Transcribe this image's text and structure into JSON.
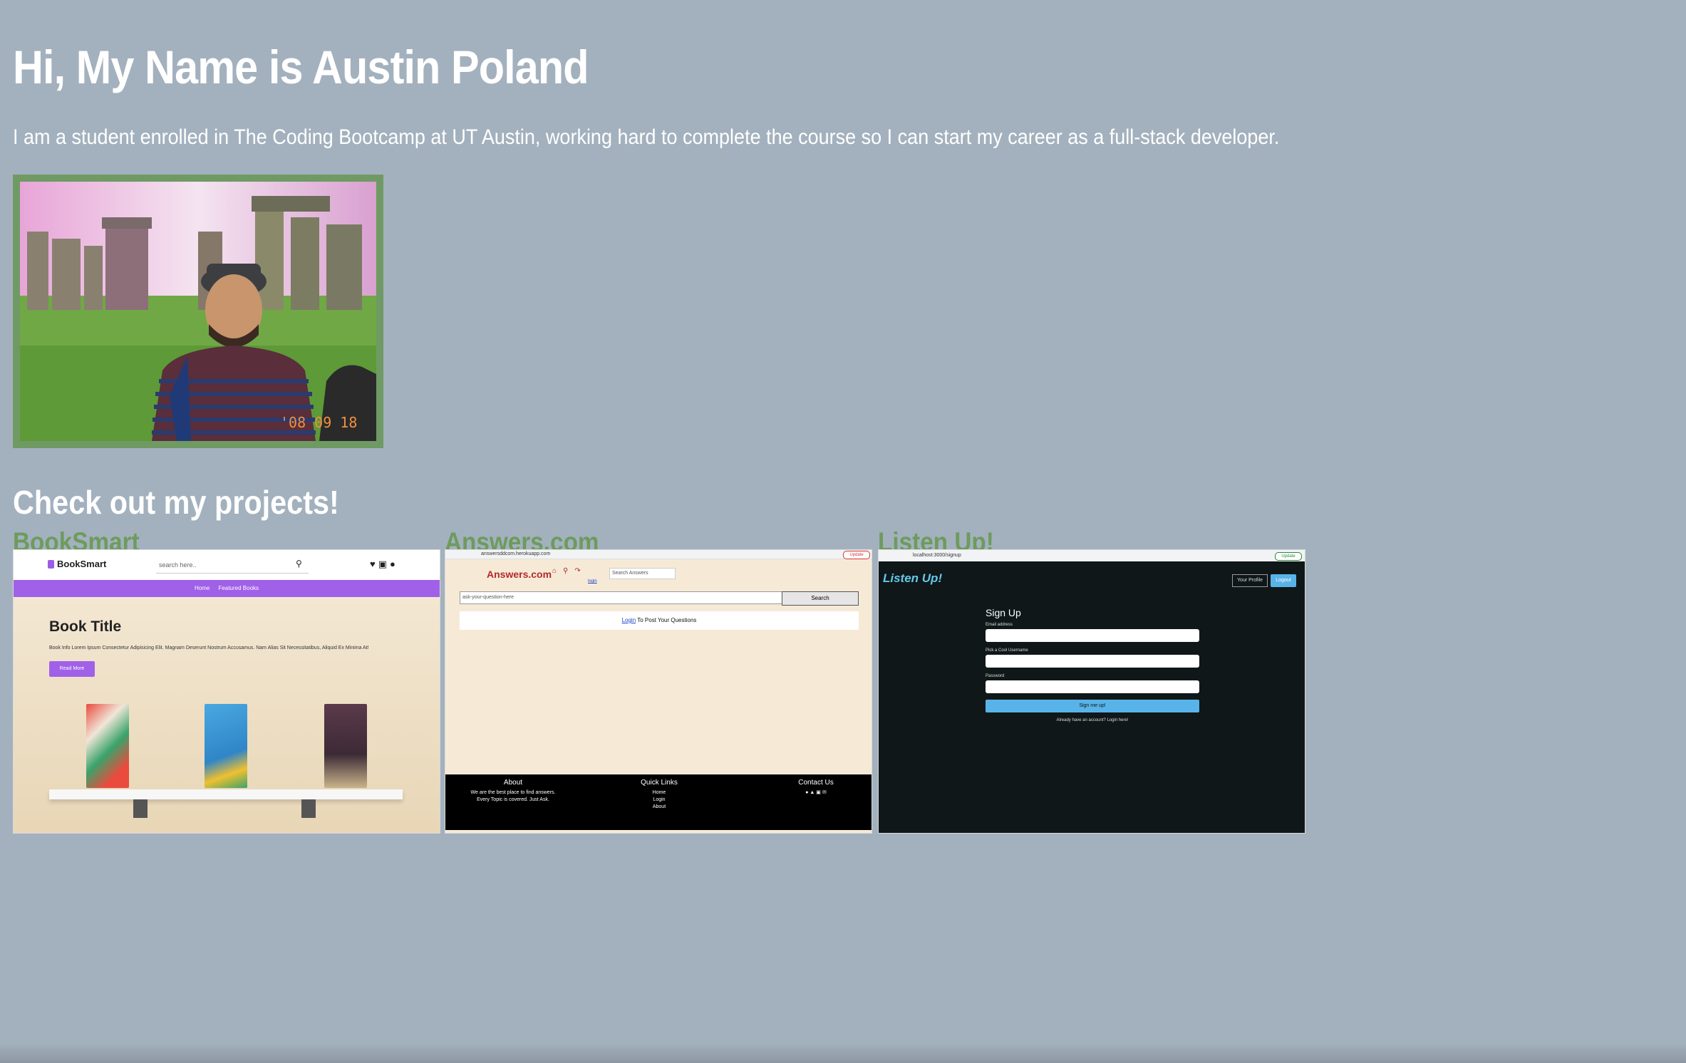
{
  "hero": {
    "title": "Hi, My Name is Austin Poland",
    "intro": "I am a student enrolled in The Coding Bootcamp at UT Austin, working hard to complete the course so I can start my career as a full-stack developer.",
    "photo_date_stamp": "'08 09 18"
  },
  "colors": {
    "background": "#a3b1be",
    "accent_green": "#6d9b5e",
    "photo_frame": "#6f9a64"
  },
  "projects": {
    "heading": "Check out my projects!",
    "items": [
      {
        "title": "BookSmart",
        "screenshot": {
          "logo": "BookSmart",
          "search_placeholder": "search here..",
          "nav": [
            "Home",
            "Featured Books"
          ],
          "book_title": "Book Title",
          "book_info": "Book Info Lorem Ipsum Consectetur Adipisicing Elit. Magnam Deserunt Nostrum Accusamus. Nam Alias Sit Necessitatibus, Aliquid Ex Minima At!",
          "read_more": "Read More"
        }
      },
      {
        "title": "Answers.com",
        "screenshot": {
          "url": "answersddcom.herokuapp.com",
          "browser_update": "Update",
          "brand": "Answers.com",
          "login_small": "login",
          "search_placeholder": "Search Answers",
          "question_placeholder": "ask-your-question-here",
          "search_button": "Search",
          "login_link": "Login",
          "login_prompt": " To Post Your Questions",
          "footer": {
            "about_heading": "About",
            "about_text_1": "We are the best place to find answers.",
            "about_text_2": "Every Topic is covered. Just Ask.",
            "links_heading": "Quick Links",
            "links": [
              "Home",
              "Login",
              "About"
            ],
            "contact_heading": "Contact Us",
            "contact_icons": "● ▲ ▣ ✉"
          }
        }
      },
      {
        "title": "Listen Up!",
        "screenshot": {
          "url": "localhost:3000/signup",
          "browser_update": "Update",
          "brand": "Listen Up!",
          "profile_button": "Your Profile",
          "logout_button": "Logout",
          "form_title": "Sign Up",
          "email_label": "Email address",
          "username_label": "Pick a Cool Username",
          "password_label": "Password",
          "submit_button": "Sign me up!",
          "login_prompt": "Already have an account? Login here!"
        }
      }
    ]
  }
}
